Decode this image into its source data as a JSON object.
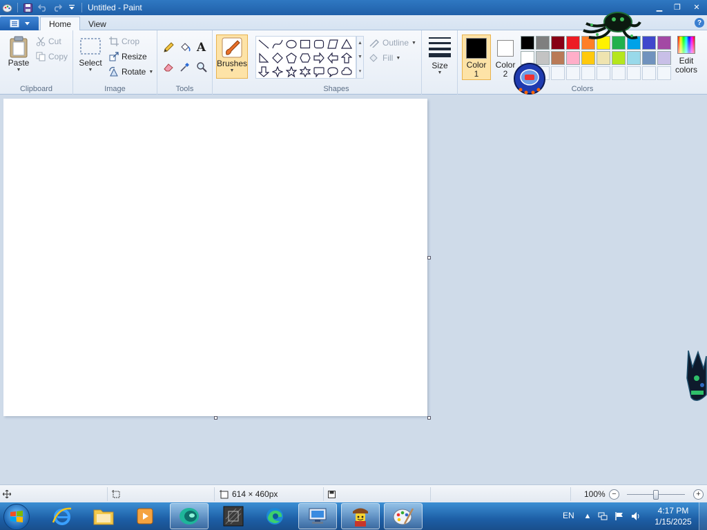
{
  "window": {
    "title": "Untitled - Paint",
    "controls": {
      "minimize": "▁",
      "maximize": "❐",
      "close": "✕"
    }
  },
  "quick_access": [
    "save-icon",
    "undo-icon",
    "redo-icon",
    "customize-dropdown-icon"
  ],
  "tabs": [
    {
      "label": "Home",
      "active": true
    },
    {
      "label": "View",
      "active": false
    }
  ],
  "help_label": "?",
  "ribbon": {
    "clipboard": {
      "label": "Clipboard",
      "paste": "Paste",
      "cut": "Cut",
      "copy": "Copy"
    },
    "image": {
      "label": "Image",
      "select": "Select",
      "crop": "Crop",
      "resize": "Resize",
      "rotate": "Rotate"
    },
    "tools": {
      "label": "Tools",
      "items": [
        "pencil-icon",
        "fill-bucket-icon",
        "text-icon",
        "eraser-icon",
        "color-picker-icon",
        "magnifier-icon"
      ],
      "text_glyph": "A"
    },
    "brushes": {
      "label": "Brushes"
    },
    "shapes": {
      "label": "Shapes",
      "outline": "Outline",
      "fill": "Fill"
    },
    "size": {
      "label": "Size"
    },
    "colors": {
      "label": "Colors",
      "color1_label": "Color 1",
      "color2_label": "Color 2",
      "color1": "#000000",
      "color2": "#ffffff",
      "edit_label": "Edit colors",
      "palette": [
        "#000000",
        "#7f7f7f",
        "#880015",
        "#ed1c24",
        "#ff7f27",
        "#fff200",
        "#22b14c",
        "#00a2e8",
        "#3f48cc",
        "#a349a4",
        "#ffffff",
        "#c3c3c3",
        "#b97a57",
        "#ffaec9",
        "#ffc90e",
        "#efe4b0",
        "#b5e61d",
        "#99d9ea",
        "#7092be",
        "#c8bfe7"
      ],
      "empty_slots": 10
    }
  },
  "canvas": {
    "background": "#ffffff"
  },
  "status": {
    "dimensions": "614 × 460px",
    "zoom": "100%",
    "zoom_level": 1.0
  },
  "taskbar": {
    "apps": [
      "start-button",
      "internet-explorer",
      "file-explorer",
      "media-player",
      "app-teal",
      "app-cube",
      "edge-browser",
      "remote-desktop",
      "lego-game",
      "paint"
    ],
    "active_app": "paint",
    "language": "EN",
    "time": "4:17 PM",
    "date": "1/15/2025"
  }
}
